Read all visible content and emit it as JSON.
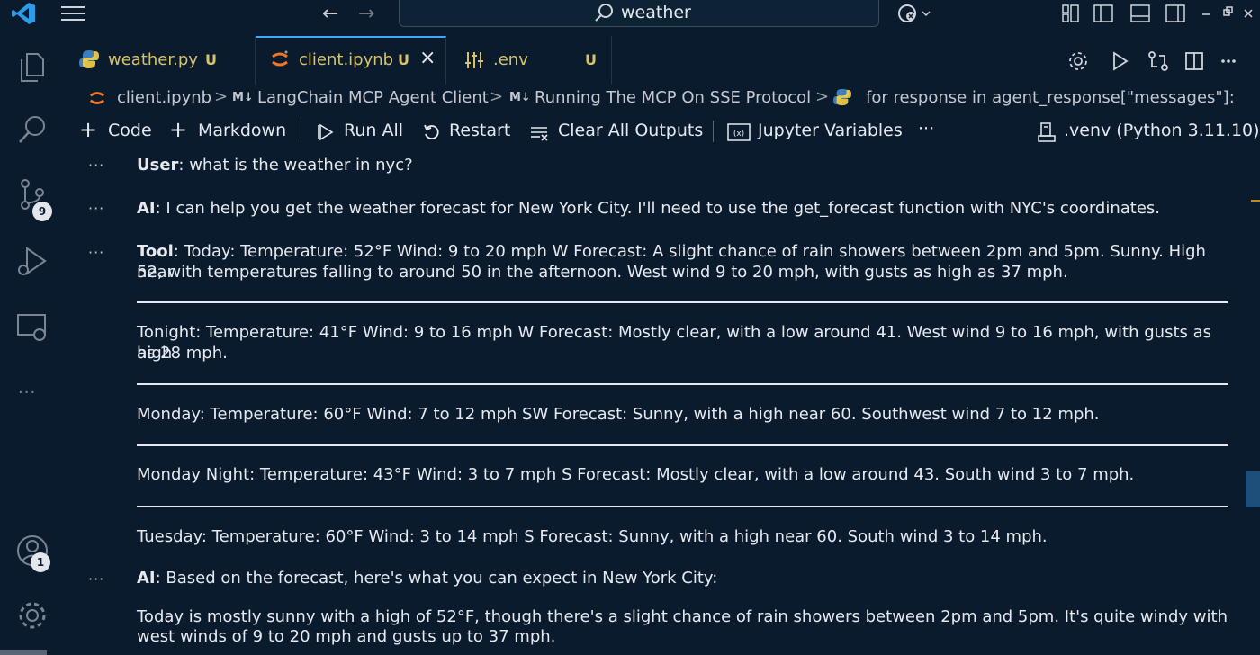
{
  "titlebar": {
    "search_text": "weather"
  },
  "tabs": [
    {
      "label": "weather.py",
      "status": "U"
    },
    {
      "label": "client.ipynb",
      "status": "U",
      "close": "×"
    },
    {
      "label": ".env",
      "status": "U"
    }
  ],
  "breadcrumb": {
    "file": "client.ipynb",
    "section1": "LangChain MCP Agent Client",
    "section2": "Running The MCP On SSE Protocol",
    "symbol": "for response in agent_response[\"messages\"]:",
    "md_badge": "M↓",
    "sep": ">"
  },
  "toolbar": {
    "code": "Code",
    "markdown": "Markdown",
    "run_all": "Run All",
    "restart": "Restart",
    "clear_outputs": "Clear All Outputs",
    "jupyter_vars": "Jupyter Variables",
    "more": "···",
    "kernel": ".venv (Python 3.11.10)"
  },
  "activity": {
    "scm_badge": "9",
    "accounts_badge": "1",
    "more": "···"
  },
  "output": {
    "cell_dots": "···",
    "user_label": "User",
    "user_text": ": what is the weather in nyc?",
    "ai_label": "AI",
    "ai1_text": ": I can help you get the weather forecast for New York City. I'll need to use the get_forecast function with NYC's coordinates.",
    "tool_label": "Tool",
    "tool_line1": ": Today: Temperature: 52°F Wind: 9 to 20 mph W Forecast: A slight chance of rain showers between 2pm and 5pm. Sunny. High near",
    "tool_line2": "52, with temperatures falling to around 50 in the afternoon. West wind 9 to 20 mph, with gusts as high as 37 mph.",
    "tonight_line1": "Tonight: Temperature: 41°F Wind: 9 to 16 mph W Forecast: Mostly clear, with a low around 41. West wind 9 to 16 mph, with gusts as high",
    "tonight_line2": "as 28 mph.",
    "monday": "Monday: Temperature: 60°F Wind: 7 to 12 mph SW Forecast: Sunny, with a high near 60. Southwest wind 7 to 12 mph.",
    "monday_night": "Monday Night: Temperature: 43°F Wind: 3 to 7 mph S Forecast: Mostly clear, with a low around 43. South wind 3 to 7 mph.",
    "tuesday": "Tuesday: Temperature: 60°F Wind: 3 to 14 mph S Forecast: Sunny, with a high near 60. South wind 3 to 14 mph.",
    "ai2_text": ": Based on the forecast, here's what you can expect in New York City:",
    "summary_line1": "Today is mostly sunny with a high of 52°F, though there's a slight chance of rain showers between 2pm and 5pm. It's quite windy with",
    "summary_line2": "west winds of 9 to 20 mph and gusts up to 37 mph."
  },
  "colors": {
    "background": "#0b1b2e",
    "accent": "#3fa7ff",
    "modified": "#d6c36a"
  }
}
